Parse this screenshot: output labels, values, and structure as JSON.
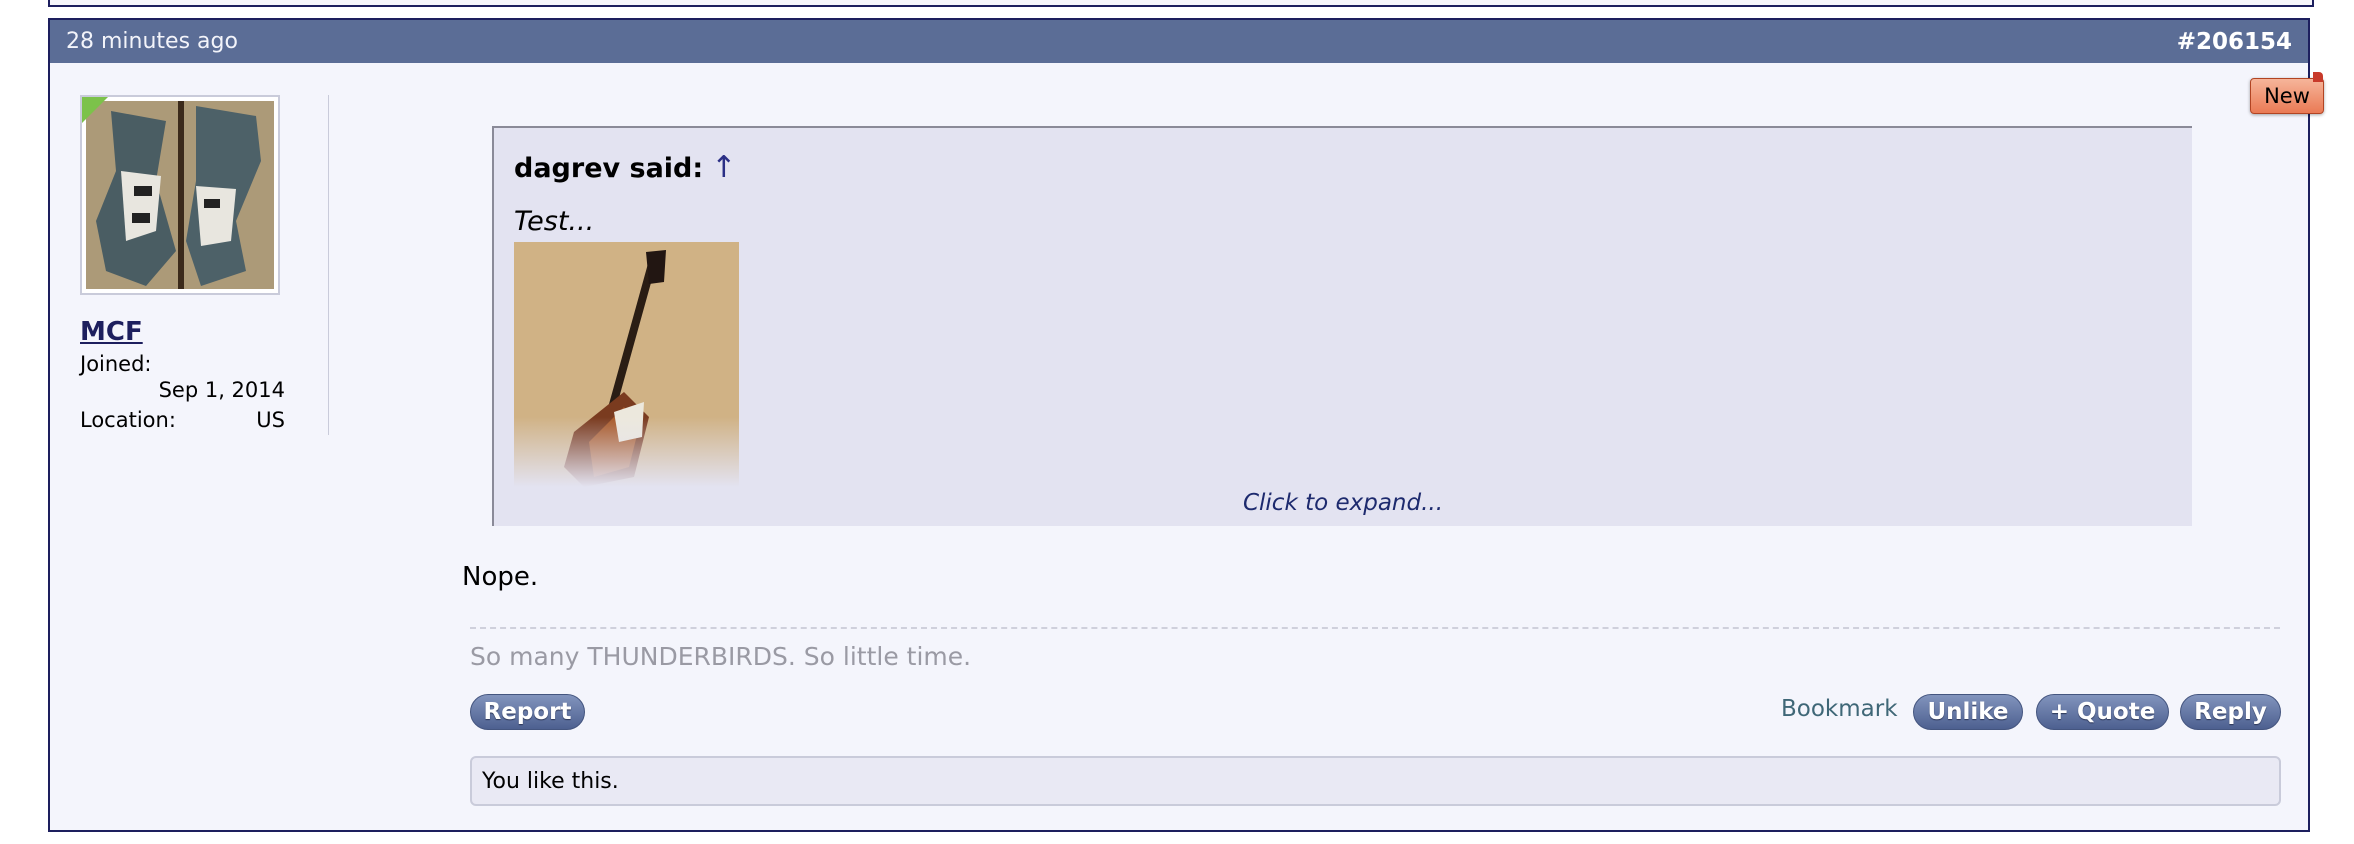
{
  "post": {
    "time": "28 minutes ago",
    "number": "#206154",
    "badge": "New"
  },
  "user": {
    "name": "MCF",
    "joined_label": "Joined:",
    "joined_value": "Sep 1, 2014",
    "location_label": "Location:",
    "location_value": "US"
  },
  "quote": {
    "author": "dagrev said:",
    "arrow": "↑",
    "text": "Test...",
    "expand": "Click to expand..."
  },
  "body": "Nope.",
  "signature": "So many THUNDERBIRDS. So little time.",
  "actions": {
    "report": "Report",
    "bookmark": "Bookmark",
    "unlike": "Unlike",
    "quote": "+ Quote",
    "reply": "Reply"
  },
  "likes": "You like this.",
  "colors": {
    "header": "#5b6d96",
    "border": "#1d1f5e",
    "button": "#5b6d96",
    "badge": "#ea7a55"
  }
}
